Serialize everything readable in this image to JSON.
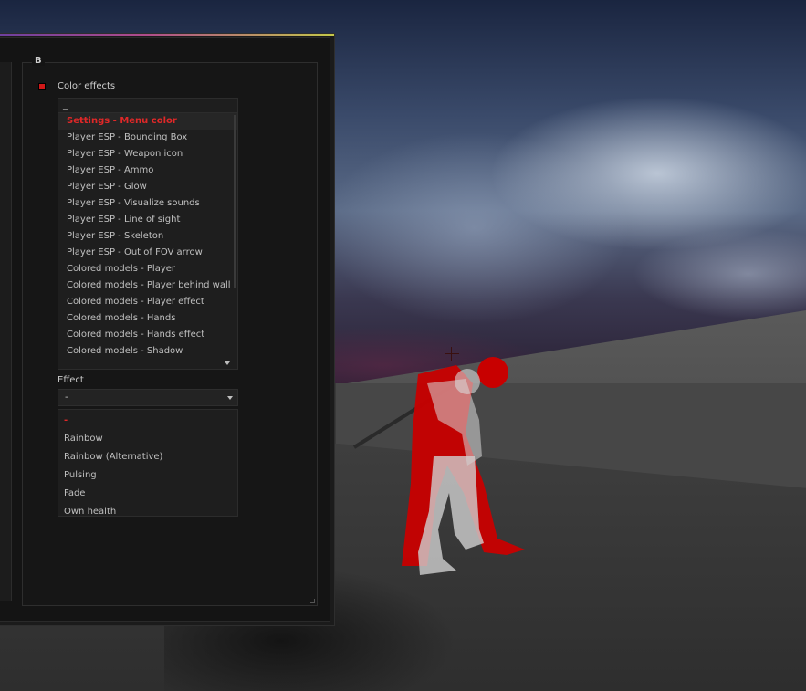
{
  "menu": {
    "group_title": "B",
    "checkbox": {
      "label": "Color effects",
      "checked": true,
      "color": "#d01818"
    },
    "search": {
      "value": "_"
    },
    "color_list": {
      "selected": "Settings - Menu color",
      "items": [
        "Settings - Menu color",
        "Player ESP - Bounding Box",
        "Player ESP - Weapon icon",
        "Player ESP - Ammo",
        "Player ESP - Glow",
        "Player ESP - Visualize sounds",
        "Player ESP - Line of sight",
        "Player ESP - Skeleton",
        "Player ESP - Out of FOV arrow",
        "Colored models - Player",
        "Colored models - Player behind wall",
        "Colored models - Player effect",
        "Colored models - Hands",
        "Colored models - Hands effect",
        "Colored models - Shadow"
      ]
    },
    "effect": {
      "label": "Effect",
      "value": "-",
      "options": [
        "-",
        "Rainbow",
        "Rainbow (Alternative)",
        "Pulsing",
        "Fade",
        "Own health"
      ]
    },
    "accent_colors": [
      "#6a3fa0",
      "#b04c8c",
      "#c4c84a"
    ],
    "selection_color": "#e02828"
  },
  "icons": {
    "dropdown": "chevron-down-icon",
    "scroll": "chevron-down-icon"
  }
}
